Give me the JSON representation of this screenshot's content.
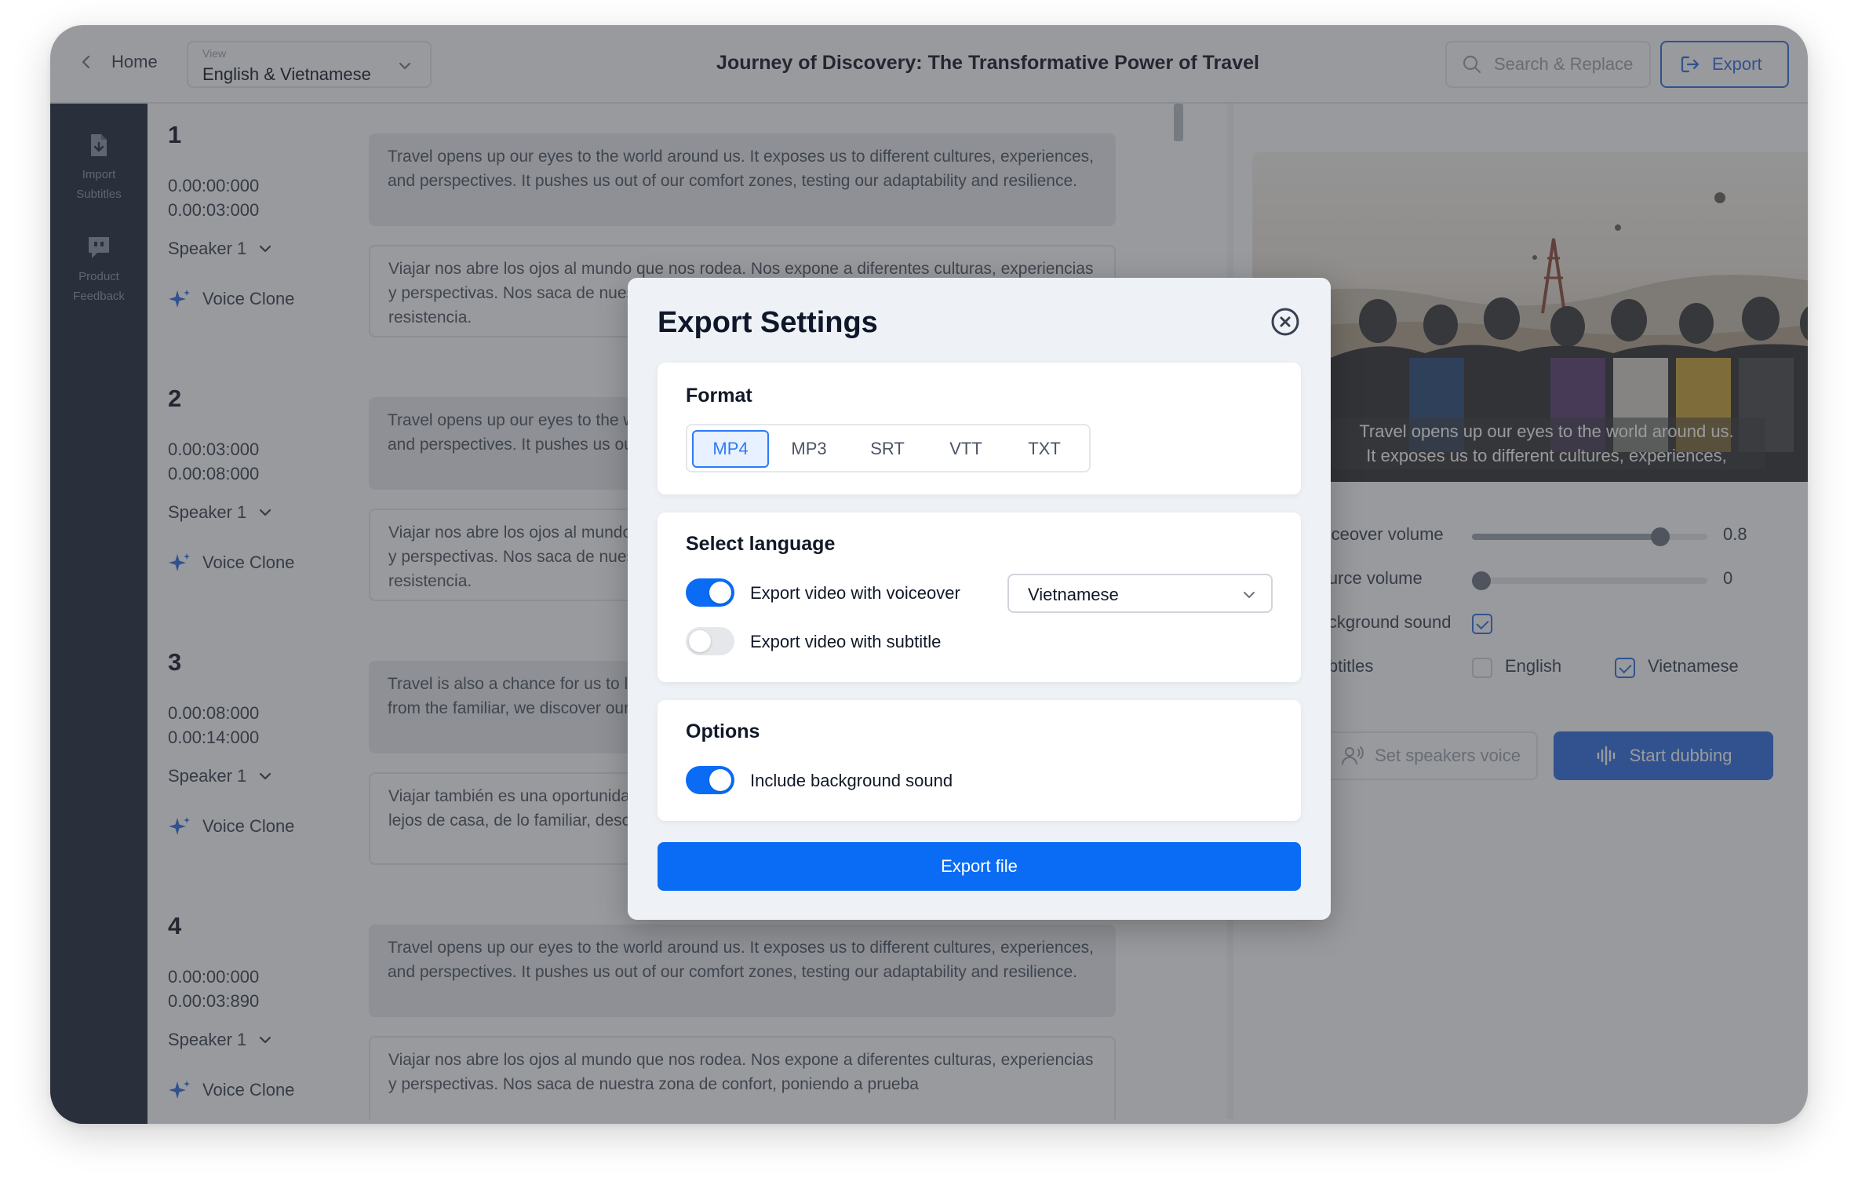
{
  "topbar": {
    "home_label": "Home",
    "view_caption": "View",
    "view_value": "English & Vietnamese",
    "title": "Journey of Discovery: The Transformative Power of Travel",
    "search_label": "Search & Replace",
    "export_label": "Export"
  },
  "sidebar": {
    "items": [
      {
        "label_line1": "Import",
        "label_line2": "Subtitles",
        "icon": "import-subtitles-icon"
      },
      {
        "label_line1": "Product",
        "label_line2": "Feedback",
        "icon": "feedback-icon"
      }
    ]
  },
  "segments": [
    {
      "number": "1",
      "start": "0.00:00:000",
      "end": "0.00:03:000",
      "speaker": "Speaker 1",
      "voice": "Voice Clone",
      "source": "Travel opens up our eyes to the world around us. It exposes us to different cultures, experiences, and perspectives. It pushes us out of our comfort zones, testing our adaptability and resilience.",
      "target": "Viajar nos abre los ojos al mundo que nos rodea. Nos expone a diferentes culturas, experiencias y perspectivas. Nos saca de nuestra zona de confort, poniendo a prueba nuestra adaptabilidad y resistencia."
    },
    {
      "number": "2",
      "start": "0.00:03:000",
      "end": "0.00:08:000",
      "speaker": "Speaker 1",
      "voice": "Voice Clone",
      "source": "Travel opens up our eyes to the world around us. It exposes us to different cultures, experiences, and perspectives. It pushes us out of our comfort zones, testing our adaptability and resilience.",
      "target": "Viajar nos abre los ojos al mundo que nos rodea. Nos expone a diferentes culturas, experiencias y perspectivas. Nos saca de nuestra zona de confort, poniendo a prueba nuestra adaptabilidad y resistencia."
    },
    {
      "number": "3",
      "start": "0.00:08:000",
      "end": "0.00:14:000",
      "speaker": "Speaker 1",
      "voice": "Voice Clone",
      "source": "Travel is also a chance for us to learn more about ourselves. When we are away from home, from the familiar, we discover our passions, our limits.",
      "target": "Viajar también es una oportunidad para aprender más sobre nosotros mismos. Cuando estamos lejos de casa, de lo familiar, descubrimos nuestras pasiones, nuestros límites."
    },
    {
      "number": "4",
      "start": "0.00:00:000",
      "end": "0.00:03:890",
      "speaker": "Speaker 1",
      "voice": "Voice Clone",
      "source": "Travel opens up our eyes to the world around us. It exposes us to different cultures, experiences, and perspectives. It pushes us out of our comfort zones, testing our adaptability and resilience.",
      "target": "Viajar nos abre los ojos al mundo que nos rodea. Nos expone a diferentes culturas, experiencias y perspectivas. Nos saca de nuestra zona de confort, poniendo a prueba"
    }
  ],
  "preview": {
    "caption_line1": "Travel opens up our eyes to the world around us.",
    "caption_line2": "It exposes us to different cultures, experiences,",
    "voiceover_label": "Voiceover volume",
    "voiceover_value": "0.8",
    "voiceover_level": 0.8,
    "source_label": "Source volume",
    "source_value": "0",
    "source_level": 0,
    "background_label": "Background sound",
    "background_checked": true,
    "subtitles_label": "Subtitles",
    "subtitle_english": "English",
    "subtitle_english_checked": false,
    "subtitle_vietnamese": "Vietnamese",
    "subtitle_vietnamese_checked": true,
    "set_voice_label": "Set speakers voice",
    "start_dubbing_label": "Start dubbing"
  },
  "modal": {
    "title": "Export Settings",
    "format_title": "Format",
    "formats": [
      "MP4",
      "MP3",
      "SRT",
      "VTT",
      "TXT"
    ],
    "selected_format": "MP4",
    "language_title": "Select language",
    "voiceover_toggle_label": "Export video with voiceover",
    "voiceover_toggle_on": true,
    "language_value": "Vietnamese",
    "subtitle_toggle_label": "Export video with subtitle",
    "subtitle_toggle_on": false,
    "options_title": "Options",
    "bg_toggle_label": "Include background sound",
    "bg_toggle_on": true,
    "export_file_label": "Export file"
  },
  "colors": {
    "accent": "#0a6cf5",
    "brand_blue": "#2f6fe0",
    "sidebar_bg": "#1f2a3c",
    "overlay": "rgba(52,54,60,0.5)"
  }
}
